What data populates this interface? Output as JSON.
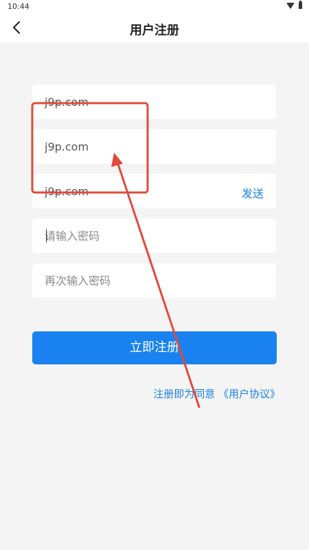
{
  "status_bar": {
    "time": "10:44"
  },
  "header": {
    "title": "用户注册"
  },
  "form": {
    "field1_value": "j9p.com",
    "field2_value": "j9p.com",
    "field3_value": "j9p.com",
    "send_label": "发送",
    "password_placeholder": "请输入密码",
    "confirm_password_placeholder": "再次输入密码",
    "submit_label": "立即注册"
  },
  "agreement": {
    "prefix": "注册即为同意",
    "link": "《用户协议》"
  },
  "colors": {
    "accent": "#1a82f0",
    "annotation_red": "#e04a3a"
  }
}
